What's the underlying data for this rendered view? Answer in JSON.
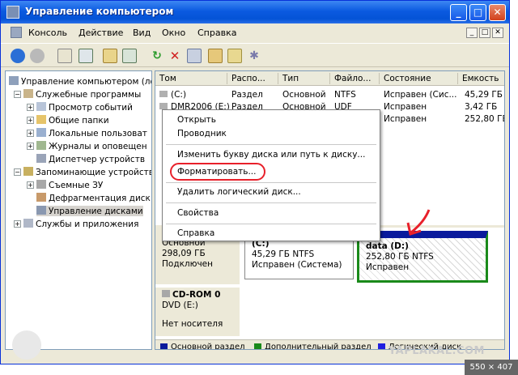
{
  "window": {
    "title": "Управление компьютером",
    "controls": {
      "minimize": "_",
      "maximize": "□",
      "close": "✕"
    }
  },
  "menu": {
    "items": [
      "Консоль",
      "Действие",
      "Вид",
      "Окно",
      "Справка"
    ],
    "mdi_controls": [
      "_",
      "□",
      "✕"
    ]
  },
  "tree": {
    "items": [
      {
        "label": "Управление компьютером (ло"
      },
      {
        "label": "Служебные программы"
      },
      {
        "label": "Просмотр событий"
      },
      {
        "label": "Общие папки"
      },
      {
        "label": "Локальные пользоват"
      },
      {
        "label": "Журналы и оповещен"
      },
      {
        "label": "Диспетчер устройств"
      },
      {
        "label": "Запоминающие устройства"
      },
      {
        "label": "Съемные ЗУ"
      },
      {
        "label": "Дефрагментация диск"
      },
      {
        "label": "Управление дисками"
      },
      {
        "label": "Службы и приложения"
      }
    ]
  },
  "volumes": {
    "columns": [
      "Том",
      "Распо...",
      "Тип",
      "Файло...",
      "Состояние",
      "Емкость"
    ],
    "rows": [
      [
        "(C:)",
        "Раздел",
        "Основной",
        "NTFS",
        "Исправен (Сис...",
        "45,29 ГБ"
      ],
      [
        "DMR2006 (E:)",
        "Раздел",
        "Основной",
        "UDF",
        "Исправен",
        "3,42 ГБ"
      ],
      [
        "",
        "",
        "",
        "",
        "Исправен",
        "252,80 ГБ"
      ]
    ]
  },
  "disks": {
    "disk0": {
      "type": "Основной",
      "size": "298,09 ГБ",
      "status": "Подключен",
      "partitions": [
        {
          "name": "(C:)",
          "size": "45,29 ГБ NTFS",
          "status": "Исправен (Система)"
        },
        {
          "name": "data  (D:)",
          "size": "252,80 ГБ NTFS",
          "status": "Исправен"
        }
      ]
    },
    "cdrom": {
      "name": "CD-ROM 0",
      "drive": "DVD (E:)",
      "status": "Нет носителя"
    }
  },
  "legend": [
    "Основной раздел",
    "Дополнительный раздел",
    "Логический диск"
  ],
  "context_menu": {
    "items": [
      "Открыть",
      "Проводник",
      "Изменить букву диска или путь к диску...",
      "Форматировать...",
      "Удалить логический диск...",
      "Свойства",
      "Справка"
    ]
  },
  "overlay": {
    "watermark": "YAPLAKAL.COM",
    "badge": "550 × 407"
  },
  "colors": {
    "primary_partition": "#0a1a9c",
    "extended_partition": "#1a8a1a",
    "logical_drive": "#2020e0",
    "title_blue": "#0b5ae0",
    "annotation_red": "#e8202a"
  }
}
